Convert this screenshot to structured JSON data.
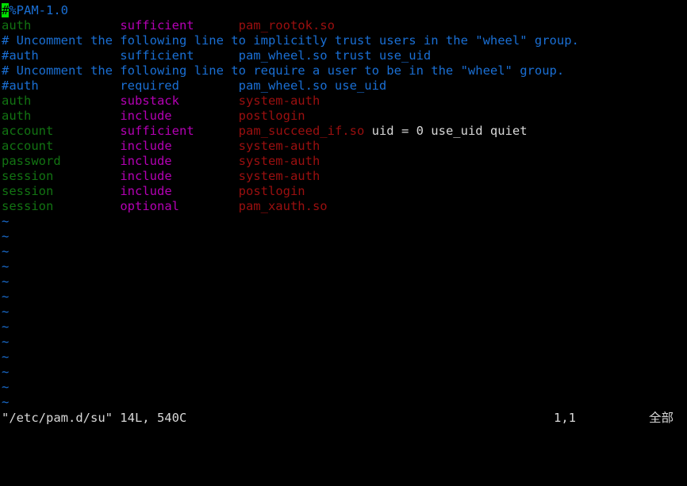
{
  "editor": {
    "name": "vim",
    "background": "#000000",
    "cursor_color": "#00e000",
    "cursor_char": "#"
  },
  "colors": {
    "comment": "#1a6fd4",
    "type": "#127312",
    "control": "#b400b4",
    "module": "#9b0f0f",
    "args": "#d8d8d8",
    "tilde": "#1a6fd4",
    "status_text": "#d8d8d8"
  },
  "buffer": {
    "lines": [
      {
        "kind": "header-comment",
        "cursor_char": "#",
        "rest": "%PAM-1.0"
      },
      {
        "kind": "rule",
        "type": "auth",
        "pad1": "            ",
        "control": "sufficient",
        "pad2": "      ",
        "module": "pam_rootok.so",
        "args": ""
      },
      {
        "kind": "comment",
        "text": "# Uncomment the following line to implicitly trust users in the \"wheel\" group."
      },
      {
        "kind": "comment",
        "text": "#auth           sufficient      pam_wheel.so trust use_uid"
      },
      {
        "kind": "comment",
        "text": "# Uncomment the following line to require a user to be in the \"wheel\" group."
      },
      {
        "kind": "comment",
        "text": "#auth           required        pam_wheel.so use_uid"
      },
      {
        "kind": "rule",
        "type": "auth",
        "pad1": "            ",
        "control": "substack",
        "pad2": "        ",
        "module": "system-auth",
        "args": ""
      },
      {
        "kind": "rule",
        "type": "auth",
        "pad1": "            ",
        "control": "include",
        "pad2": "         ",
        "module": "postlogin",
        "args": ""
      },
      {
        "kind": "rule",
        "type": "account",
        "pad1": "         ",
        "control": "sufficient",
        "pad2": "      ",
        "module": "pam_succeed_if.so",
        "args": " uid = 0 use_uid quiet"
      },
      {
        "kind": "rule",
        "type": "account",
        "pad1": "         ",
        "control": "include",
        "pad2": "         ",
        "module": "system-auth",
        "args": ""
      },
      {
        "kind": "rule",
        "type": "password",
        "pad1": "        ",
        "control": "include",
        "pad2": "         ",
        "module": "system-auth",
        "args": ""
      },
      {
        "kind": "rule",
        "type": "session",
        "pad1": "         ",
        "control": "include",
        "pad2": "         ",
        "module": "system-auth",
        "args": ""
      },
      {
        "kind": "rule",
        "type": "session",
        "pad1": "         ",
        "control": "include",
        "pad2": "         ",
        "module": "postlogin",
        "args": ""
      },
      {
        "kind": "rule",
        "type": "session",
        "pad1": "         ",
        "control": "optional",
        "pad2": "        ",
        "module": "pam_xauth.so",
        "args": ""
      }
    ],
    "empty_marker": "~",
    "empty_marker_count": 13
  },
  "statusline": {
    "file": "\"/etc/pam.d/su\" 14L, 540C",
    "position": "1,1",
    "scroll": "全部"
  }
}
